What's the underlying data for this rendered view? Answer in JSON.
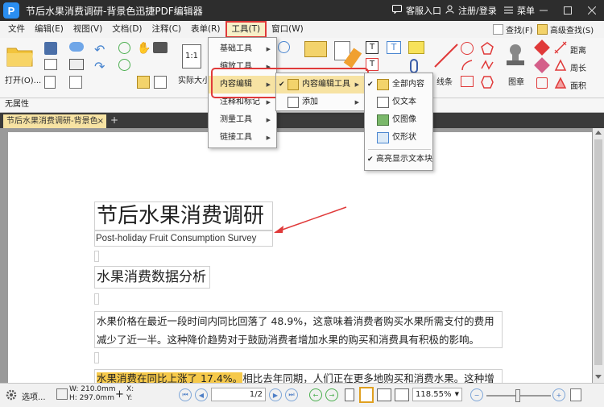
{
  "titlebar": {
    "app_logo": "P",
    "title": "节后水果消费调研-背景色迅捷PDF编辑器",
    "service": "客服入口",
    "login": "注册/登录",
    "menu": "菜单"
  },
  "menubar": {
    "items": [
      "文件",
      "编辑(E)",
      "视图(V)",
      "文档(D)",
      "注释(C)",
      "表单(R)",
      "工具(T)",
      "窗口(W)"
    ],
    "find": "查找(F)",
    "advanced_find": "高级查找(S)"
  },
  "ribbon": {
    "open_label": "打开(O)...",
    "actual_size": "实际大小",
    "line_label": "线条",
    "stamp_label": "图章",
    "distance": "距离",
    "perimeter": "周长",
    "area": "面积",
    "actual_size_number": "1:1"
  },
  "properties_bar": "无属性",
  "tab": {
    "label": "节后水果消费调研-背景色",
    "close": "×",
    "add": "+"
  },
  "tools_menu": {
    "items": [
      "基础工具",
      "缩放工具",
      "内容编辑",
      "注释和标记",
      "测量工具",
      "链接工具"
    ]
  },
  "content_edit_menu": {
    "items": [
      "内容编辑工具",
      "添加"
    ]
  },
  "content_tool_menu": {
    "items": [
      "全部内容",
      "仅文本",
      "仅图像",
      "仅形状"
    ],
    "highlight": "高亮显示文本块"
  },
  "document": {
    "title": "节后水果消费调研",
    "subtitle": "Post-holiday Fruit Consumption Survey",
    "heading": "水果消费数据分析",
    "para1_line1": "水果价格在最近一段时间内同比回落了 48.9%，这意味着消费者购买水果所需支付的费用",
    "para1_line2": "减少了近一半。这种降价趋势对于鼓励消费者增加水果的购买和消费具有积极的影响。",
    "para2_highlight": "水果消费在同比上涨了 17.4%。",
    "para2_rest": "相比去年同期，人们正在更多地购买和消费水果。这种增长"
  },
  "statusbar": {
    "options": "选项...",
    "width": "W: 210.0mm",
    "height": "H: 297.0mm",
    "x": "X:",
    "y": "Y:",
    "page_current": "1",
    "page_total": "/2",
    "zoom": "118.55%"
  },
  "colors": {
    "titlebar": "#2d2d2d",
    "accent_red": "#e03a3a",
    "highlight_yellow": "#f6c94a",
    "tab_bg": "#f7e3a3"
  }
}
